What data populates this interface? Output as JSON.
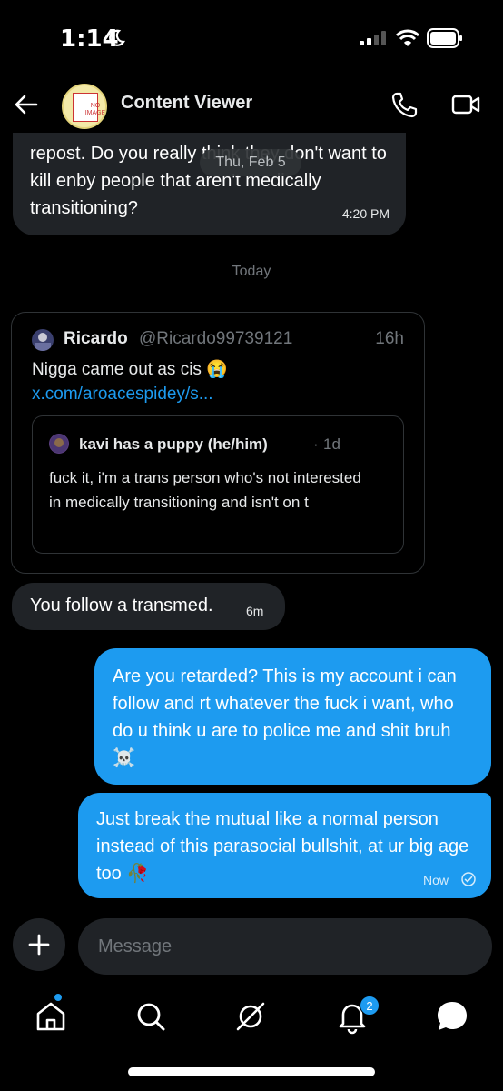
{
  "status_bar": {
    "time": "1:14",
    "icons": [
      "moon-icon",
      "signal-icon",
      "wifi-icon",
      "battery-icon"
    ]
  },
  "header": {
    "title": "Content Viewer",
    "avatar_text": "NO IMAGE",
    "icons": [
      "back-arrow-icon",
      "phone-icon",
      "video-icon"
    ]
  },
  "chat": {
    "date_chip": "Thu, Feb 5",
    "day_separator": "Today",
    "messages": [
      {
        "id": "in-1",
        "direction": "incoming",
        "text": "repost. Do you really think they don't want to kill enby people that aren't medically transitioning?",
        "time": "4:20 PM"
      },
      {
        "id": "shared-post",
        "direction": "incoming",
        "type": "tweet",
        "author_name": "Ricardo",
        "author_handle": "@Ricardo99739121",
        "age": "16h",
        "text": "Nigga came out as cis 😭",
        "link": "x.com/aroacespidey/s...",
        "quote": {
          "author_name": "kavi has a puppy (he/him)",
          "separator": "·",
          "age": "1d",
          "text": "fuck it, i'm a trans person who's not interested in medically transitioning and isn't on t"
        }
      },
      {
        "id": "in-2",
        "direction": "incoming",
        "text": "You follow a transmed.",
        "time": "6m"
      },
      {
        "id": "out-1",
        "direction": "outgoing",
        "text": "Are you retarded? This is my account i can follow and rt whatever the fuck i want, who do u think u are to police me and shit bruh ☠️"
      },
      {
        "id": "out-2",
        "direction": "outgoing",
        "text": "Just break the mutual like a normal person instead of this parasocial bullshit, at ur big age too 🥀",
        "time": "Now",
        "status_icon": "sent-check-icon"
      }
    ]
  },
  "composer": {
    "placeholder": "Message",
    "add_icon": "plus-icon"
  },
  "tabbar": {
    "tabs": [
      "home-icon",
      "search-icon",
      "grok-icon",
      "notifications-icon",
      "messages-icon"
    ],
    "notifications_badge": "2"
  },
  "colors": {
    "accent": "#1d9bf0",
    "bubble_incoming": "#202327",
    "background": "#000000",
    "muted": "#71767b"
  }
}
